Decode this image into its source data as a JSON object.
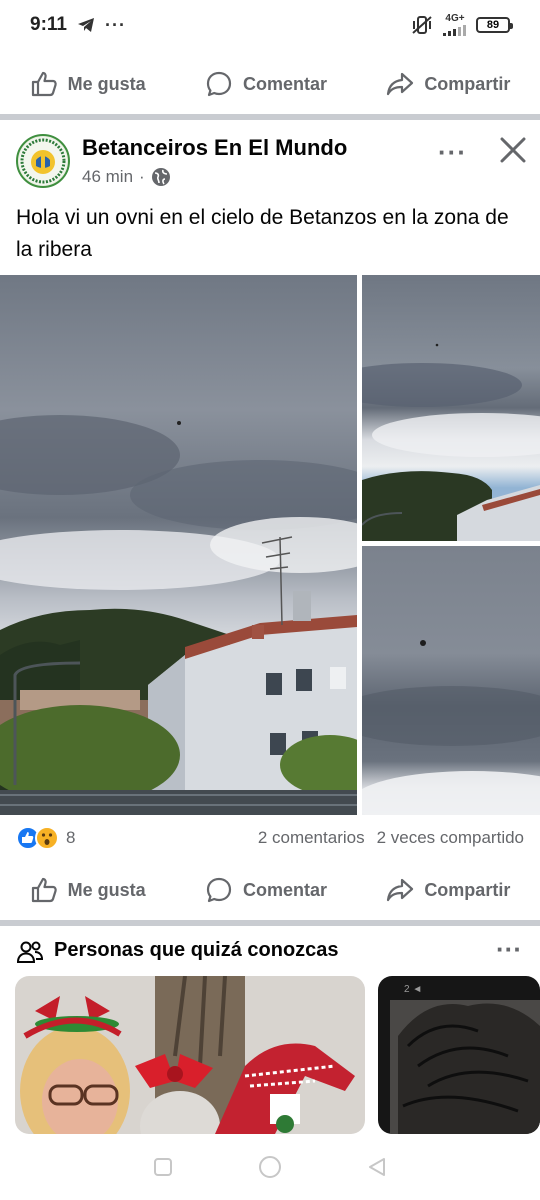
{
  "status_bar": {
    "time": "9:11",
    "network": "4G+",
    "battery": "89"
  },
  "actions": {
    "like": "Me gusta",
    "comment": "Comentar",
    "share": "Compartir"
  },
  "post": {
    "page_name": "Betanceiros En El Mundo",
    "time_ago": "46 min",
    "separator": "·",
    "text": "Hola vi un ovni en el cielo de Betanzos en la zona de la ribera",
    "reaction_count": "8",
    "comments": "2 comentarios",
    "shares": "2 veces compartido"
  },
  "pymk": {
    "title": "Personas que quizá conozcas"
  },
  "icons": {
    "like": "thumbs-up-icon",
    "comment": "comment-bubble-icon",
    "share": "share-arrow-icon",
    "audience": "globe-icon",
    "close": "close-icon",
    "more": "more-icon",
    "people": "people-icon"
  },
  "colors": {
    "accent": "#1877f2",
    "muted_text": "#65676b",
    "divider": "#c9ccd1"
  }
}
